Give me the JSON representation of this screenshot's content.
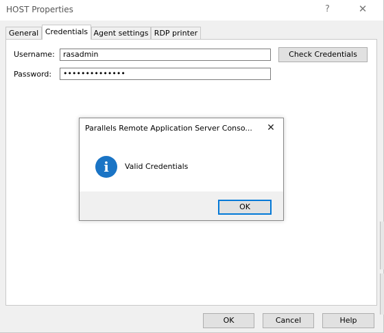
{
  "window": {
    "title": "HOST Properties",
    "help_glyph": "?",
    "close_glyph": "✕"
  },
  "tabs": [
    {
      "label": "General",
      "active": false
    },
    {
      "label": "Credentials",
      "active": true
    },
    {
      "label": "Agent settings",
      "active": false
    },
    {
      "label": "RDP printer",
      "active": false
    }
  ],
  "credentials": {
    "username_label": "Username:",
    "username_value": "rasadmin",
    "password_label": "Password:",
    "password_value": "••••••••••••••",
    "check_button": "Check Credentials"
  },
  "message_box": {
    "title": "Parallels Remote Application Server Conso...",
    "close_glyph": "✕",
    "icon": "info-icon",
    "icon_glyph": "i",
    "icon_color": "#1a74c5",
    "text": "Valid Credentials",
    "ok_label": "OK"
  },
  "footer": {
    "ok_label": "OK",
    "cancel_label": "Cancel",
    "help_label": "Help"
  },
  "colors": {
    "accent": "#0078d7",
    "window_bg": "#f0f0f0"
  }
}
